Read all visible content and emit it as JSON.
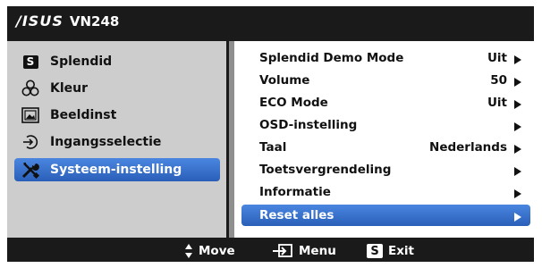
{
  "header": {
    "brand": "/ISUS",
    "model": "VN248"
  },
  "sidebar": {
    "items": [
      {
        "label": "Splendid",
        "icon": "s-key-icon",
        "selected": false
      },
      {
        "label": "Kleur",
        "icon": "color-wheel-icon",
        "selected": false
      },
      {
        "label": "Beeldinst",
        "icon": "picture-icon",
        "selected": false
      },
      {
        "label": "Ingangsselectie",
        "icon": "input-arrow-icon",
        "selected": false
      },
      {
        "label": "Systeem-instelling",
        "icon": "tools-icon",
        "selected": true
      }
    ]
  },
  "settings": {
    "rows": [
      {
        "label": "Splendid Demo Mode",
        "value": "Uit"
      },
      {
        "label": "Volume",
        "value": "50"
      },
      {
        "label": "ECO Mode",
        "value": "Uit"
      },
      {
        "label": "OSD-instelling",
        "value": ""
      },
      {
        "label": "Taal",
        "value": "Nederlands"
      },
      {
        "label": "Toetsvergrendeling",
        "value": ""
      },
      {
        "label": "Informatie",
        "value": ""
      },
      {
        "label": "Reset alles",
        "value": "",
        "selected": true
      }
    ]
  },
  "footer": {
    "move_label": "Move",
    "menu_label": "Menu",
    "exit_label": "Exit",
    "exit_key": "S",
    "splendid_key": "S"
  },
  "colors": {
    "osd_background": "#1a1a1a",
    "left_panel": "#cdcdcd",
    "divider": "#8f8f8f",
    "highlight": "#2e69c4"
  }
}
